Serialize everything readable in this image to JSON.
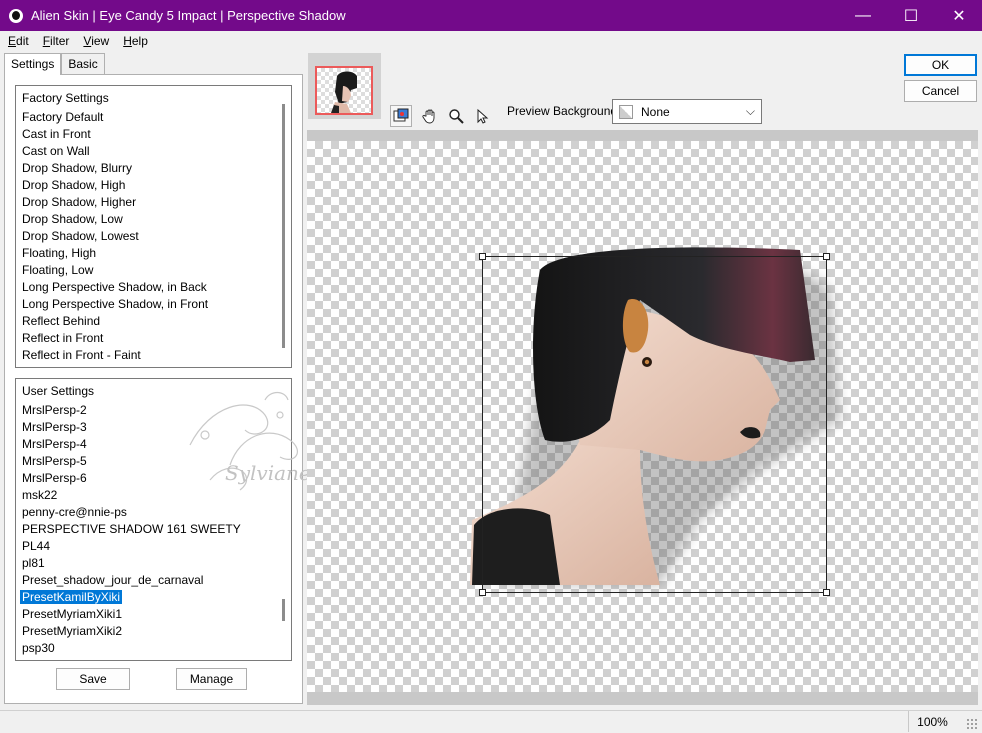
{
  "window": {
    "title": "Alien Skin | Eye Candy 5 Impact | Perspective Shadow",
    "controls": {
      "minimize": "—",
      "maximize": "☐",
      "close": "✕"
    }
  },
  "menu": [
    {
      "accel": "E",
      "rest": "dit"
    },
    {
      "accel": "F",
      "rest": "ilter"
    },
    {
      "accel": "V",
      "rest": "iew"
    },
    {
      "accel": "H",
      "rest": "elp"
    }
  ],
  "tabs": {
    "settings": "Settings",
    "basic": "Basic"
  },
  "factory": {
    "header": "Factory Settings",
    "items": [
      "Factory Default",
      "Cast in Front",
      "Cast on Wall",
      "Drop Shadow, Blurry",
      "Drop Shadow, High",
      "Drop Shadow, Higher",
      "Drop Shadow, Low",
      "Drop Shadow, Lowest",
      "Floating, High",
      "Floating, Low",
      "Long Perspective Shadow, in Back",
      "Long Perspective Shadow, in Front",
      "Reflect Behind",
      "Reflect in Front",
      "Reflect in Front - Faint"
    ]
  },
  "user": {
    "header": "User Settings",
    "items": [
      "MrslPersp-2",
      "MrslPersp-3",
      "MrslPersp-4",
      "MrslPersp-5",
      "MrslPersp-6",
      "msk22",
      "penny-cre@nnie-ps",
      "PERSPECTIVE SHADOW 161 SWEETY",
      "PL44",
      "pl81",
      "Preset_shadow_jour_de_carnaval",
      "PresetKamilByXiki",
      "PresetMyriamXiki1",
      "PresetMyriamXiki2",
      "psp30"
    ],
    "selected_index": 11
  },
  "buttons": {
    "save": "Save",
    "manage": "Manage",
    "ok": "OK",
    "cancel": "Cancel"
  },
  "tools": [
    "navigator-icon",
    "hand-icon",
    "zoom-icon",
    "pointer-icon"
  ],
  "preview_background": {
    "label": "Preview Background:",
    "value": "None"
  },
  "watermark_text": "Sylviane",
  "status": {
    "zoom": "100%"
  },
  "colors": {
    "titlebar": "#730a8a",
    "selection": "#0078d7",
    "thumb_border": "#ec5a5a"
  }
}
